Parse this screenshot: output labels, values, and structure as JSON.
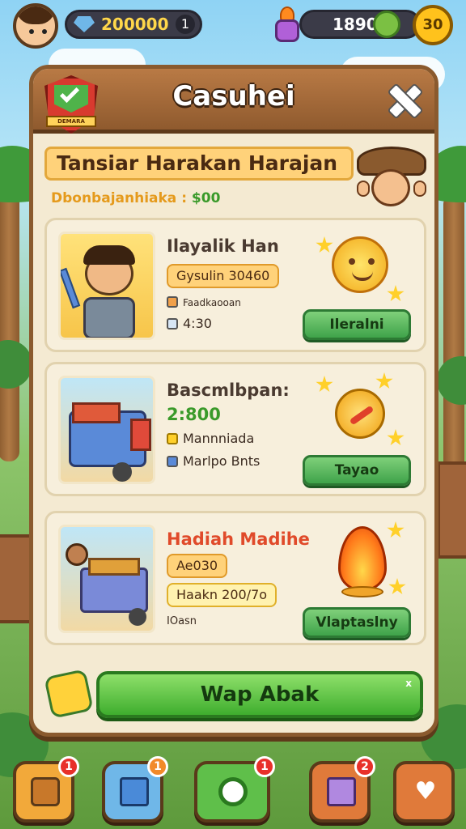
{
  "top_bar": {
    "coins": "200000",
    "coins_plus": "1",
    "energy": "1890",
    "token_label": "30"
  },
  "modal": {
    "title": "Casuhei",
    "badge_text": "DEMARA",
    "banner": "Tansiar Harakan Harajan",
    "subline_label": "Dbonbajanhiaka : ",
    "subline_amount": "$00"
  },
  "cards": [
    {
      "title": "Ilayalik Han",
      "chip": "Gysulin 30460",
      "meta1": "Faadkaooan",
      "meta2": "4:30",
      "button": "Ileralni"
    },
    {
      "title": "Bascmlbpan:",
      "timer": "2:800",
      "meta1": "Mannniada",
      "meta2": "Marlpo Bnts",
      "button": "Tayao"
    },
    {
      "title": "Hadiah Madihe",
      "chip": "Ae030",
      "chip2": "Haakn 200/7o",
      "meta1": "IOasn",
      "button": "Vlaptaslny"
    }
  ],
  "primary_button": "Wap Abak",
  "primary_badge": "x",
  "nav": [
    {
      "name": "chest",
      "badge": "1",
      "color": "#f2a93a"
    },
    {
      "name": "gift",
      "badge": "1",
      "color": "#6fb7e8"
    },
    {
      "name": "chat",
      "badge": "1",
      "color": "#5fbf4a"
    },
    {
      "name": "mail",
      "badge": "2",
      "color": "#e07a3a"
    },
    {
      "name": "heart",
      "badge": "",
      "color": "#e07a3a"
    }
  ]
}
